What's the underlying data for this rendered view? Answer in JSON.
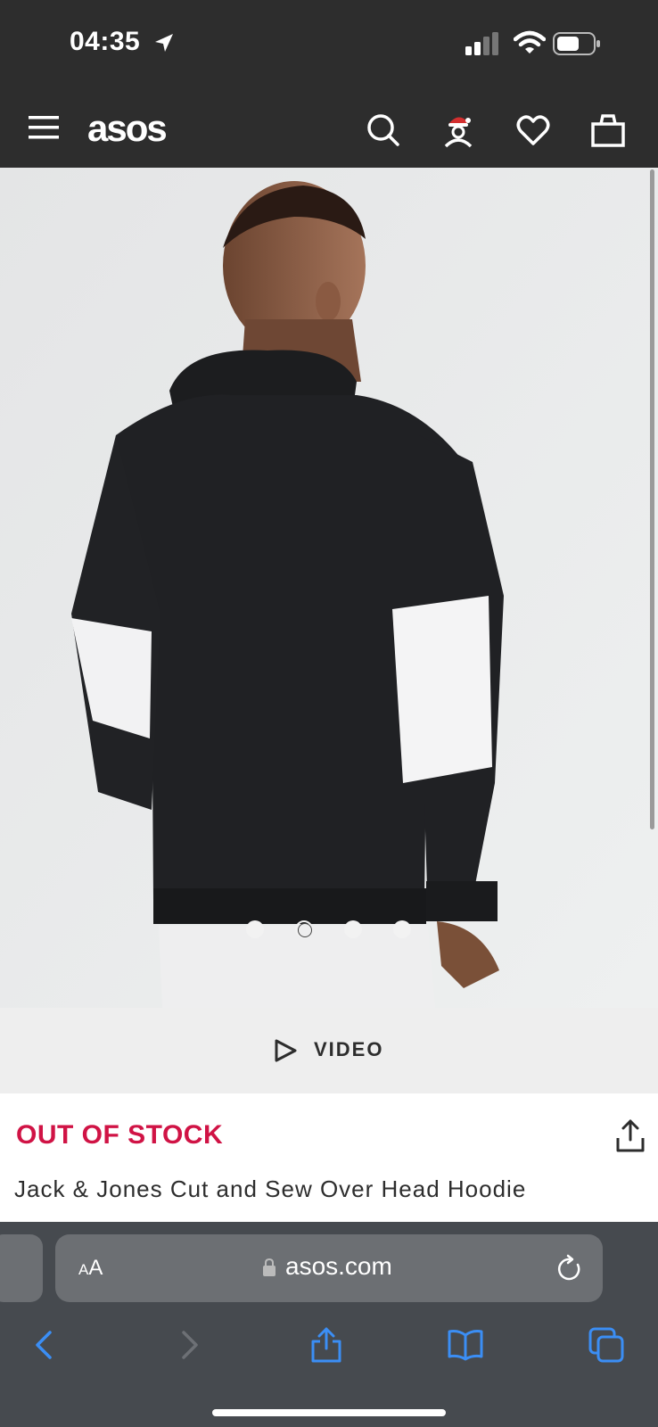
{
  "status_bar": {
    "time": "04:35",
    "location_icon": "location-arrow-icon",
    "signal_icon": "cellular-signal-icon",
    "wifi_icon": "wifi-icon",
    "battery_icon": "battery-icon"
  },
  "header": {
    "logo": "asos",
    "menu_icon": "hamburger-menu-icon",
    "search_icon": "search-icon",
    "account_icon": "account-santa-icon",
    "wishlist_icon": "heart-icon",
    "bag_icon": "shopping-bag-icon",
    "background": "#2d2d2d"
  },
  "gallery": {
    "image_description_icon": "product-photo",
    "dots_total": 4,
    "active_dot": 1
  },
  "video": {
    "label": "VIDEO",
    "icon": "play-outline-icon"
  },
  "product": {
    "stock_status": "OUT OF STOCK",
    "title": "Jack & Jones Cut and Sew Over Head Hoodie",
    "share_icon": "share-icon",
    "stock_color": "#d01345"
  },
  "browser": {
    "text_size_large": "A",
    "text_size_small": "A",
    "url": "asos.com",
    "lock_icon": "lock-icon",
    "reload_icon": "reload-icon",
    "back_icon": "back-chevron-icon",
    "forward_icon": "forward-chevron-icon",
    "share_icon": "share-icon",
    "bookmarks_icon": "book-icon",
    "tabs_icon": "tabs-icon",
    "accent_color": "#3b8ef5"
  }
}
